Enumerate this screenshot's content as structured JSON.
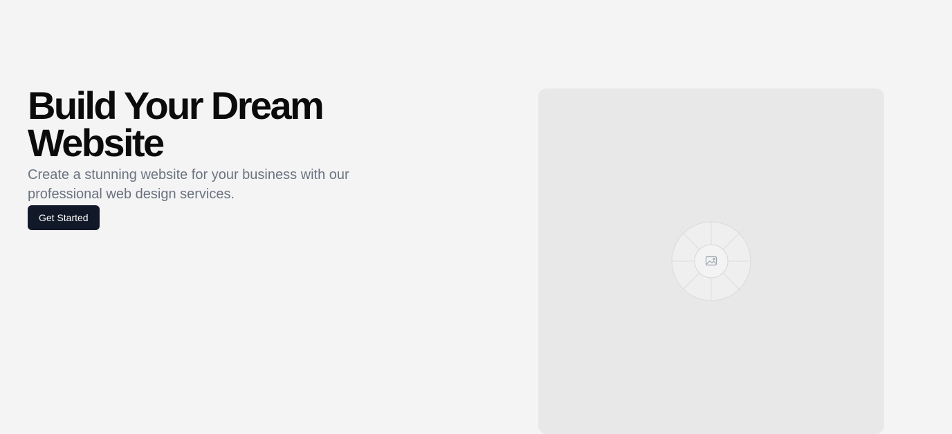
{
  "hero": {
    "title_line1": "Build Your Dream",
    "title_line2": "Website",
    "subtitle": "Create a stunning website for your business with our professional web design services.",
    "cta_label": "Get Started"
  },
  "media": {
    "icon": "image-icon"
  },
  "colors": {
    "background": "#f4f4f4",
    "title": "#0b0b0b",
    "subtitle": "#6b7280",
    "button_bg": "#111827",
    "button_text": "#ffffff",
    "placeholder_bg": "#e8e8e8"
  }
}
